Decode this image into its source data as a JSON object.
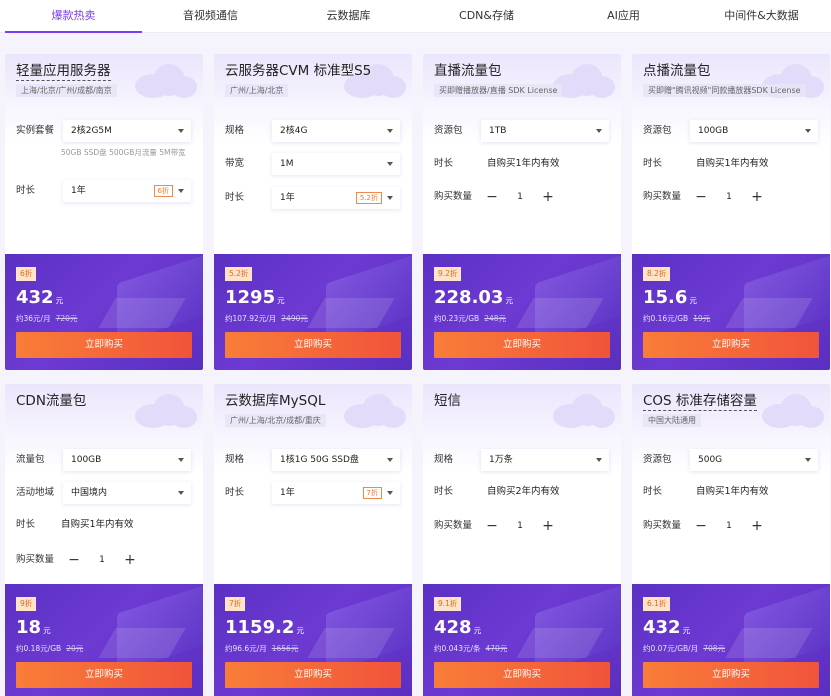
{
  "tabs": [
    "爆款热卖",
    "音视频通信",
    "云数据库",
    "CDN&存储",
    "AI应用",
    "中间件&大数据"
  ],
  "colors": {
    "accent": "#7a3ff0",
    "buy_button": "#f4663a",
    "price_panel": "#6336c9"
  },
  "buy_label": "立即购买",
  "cards": [
    {
      "title": "轻量应用服务器",
      "subtitle": "上海/北京/广州/成都/南京",
      "spec_label": "实例套餐",
      "spec_value": "2核2G5M",
      "note": "50GB SSD盘 500GB月流量 5M带宽",
      "duration_label": "时长",
      "duration_value": "1年",
      "duration_badge": "6折",
      "discount": "6折",
      "price": "432",
      "price_unit": "元",
      "unit_price": "约36元/月",
      "original_price": "720元"
    },
    {
      "title": "云服务器CVM 标准型S5",
      "subtitle": "广州/上海/北京",
      "spec_label": "规格",
      "spec_value": "2核4G",
      "bw_label": "带宽",
      "bw_value": "1M",
      "duration_label": "时长",
      "duration_value": "1年",
      "duration_badge": "5.2折",
      "discount": "5.2折",
      "price": "1295",
      "price_unit": "元",
      "unit_price": "约107.92元/月",
      "original_price": "2490元"
    },
    {
      "title": "直播流量包",
      "subtitle": "买即赠播放器/直播 SDK License",
      "spec_label": "资源包",
      "spec_value": "1TB",
      "duration_label": "时长",
      "duration_text": "自购买1年内有效",
      "qty_label": "购买数量",
      "qty": "1",
      "minus": "−",
      "plus": "+",
      "discount": "9.2折",
      "price": "228.03",
      "price_unit": "元",
      "unit_price": "约0.23元/GB",
      "original_price": "248元"
    },
    {
      "title": "点播流量包",
      "subtitle": "买即赠\"腾讯视频\"同款播放器SDK License",
      "spec_label": "资源包",
      "spec_value": "100GB",
      "duration_label": "时长",
      "duration_text": "自购买1年内有效",
      "qty_label": "购买数量",
      "qty": "1",
      "minus": "−",
      "plus": "+",
      "discount": "8.2折",
      "price": "15.6",
      "price_unit": "元",
      "unit_price": "约0.16元/GB",
      "original_price": "19元"
    },
    {
      "title": "CDN流量包",
      "spec_label": "流量包",
      "spec_value": "100GB",
      "region_label": "活动地域",
      "region_value": "中国境内",
      "duration_label": "时长",
      "duration_text": "自购买1年内有效",
      "qty_label": "购买数量",
      "qty": "1",
      "minus": "−",
      "plus": "+",
      "discount": "9折",
      "price": "18",
      "price_unit": "元",
      "unit_price": "约0.18元/GB",
      "original_price": "20元"
    },
    {
      "title": "云数据库MySQL",
      "subtitle": "广州/上海/北京/成都/重庆",
      "spec_label": "规格",
      "spec_value": "1核1G 50G SSD盘",
      "duration_label": "时长",
      "duration_value": "1年",
      "duration_badge": "7折",
      "discount": "7折",
      "price": "1159.2",
      "price_unit": "元",
      "unit_price": "约96.6元/月",
      "original_price": "1656元"
    },
    {
      "title": "短信",
      "spec_label": "规格",
      "spec_value": "1万条",
      "duration_label": "时长",
      "duration_text": "自购买2年内有效",
      "qty_label": "购买数量",
      "qty": "1",
      "minus": "−",
      "plus": "+",
      "discount": "9.1折",
      "price": "428",
      "price_unit": "元",
      "unit_price": "约0.043元/条",
      "original_price": "470元"
    },
    {
      "title": "COS 标准存储容量",
      "subtitle": "中国大陆通用",
      "spec_label": "资源包",
      "spec_value": "500G",
      "duration_label": "时长",
      "duration_text": "自购买1年内有效",
      "qty_label": "购买数量",
      "qty": "1",
      "minus": "−",
      "plus": "+",
      "discount": "6.1折",
      "price": "432",
      "price_unit": "元",
      "unit_price": "约0.07元/GB/月",
      "original_price": "708元"
    }
  ]
}
